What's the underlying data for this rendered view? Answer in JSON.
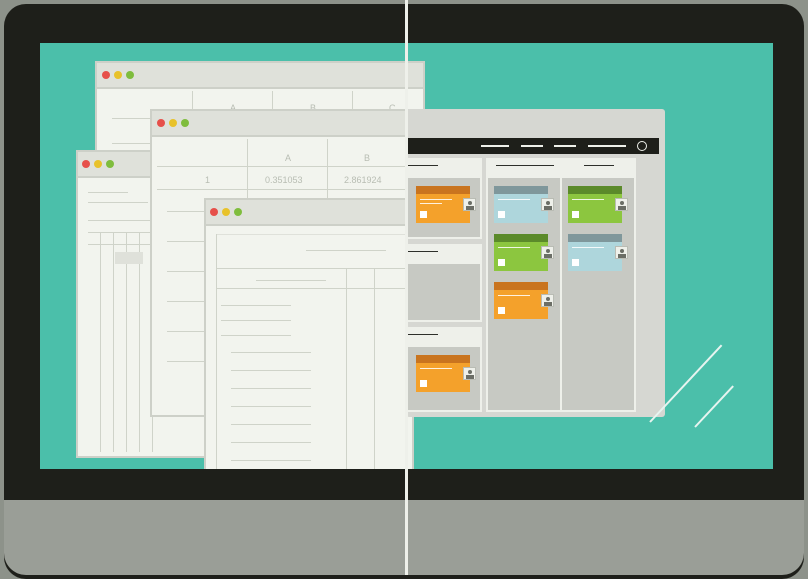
{
  "illustration": {
    "left_side": "spreadsheet-windows",
    "right_side": "kanban-board"
  },
  "spreadsheet_back": {
    "columns": [
      "A",
      "B",
      "C"
    ]
  },
  "spreadsheet_mid": {
    "columns": [
      "A",
      "B"
    ],
    "row1": {
      "index": "1",
      "a": "0.351053",
      "b": "2.861924"
    }
  },
  "colors": {
    "screen": "#4bbfaa",
    "bezel": "#1e1f1a",
    "card_orange": "#f4a12b",
    "card_green": "#8cc63f",
    "card_blue": "#aed6dc"
  }
}
